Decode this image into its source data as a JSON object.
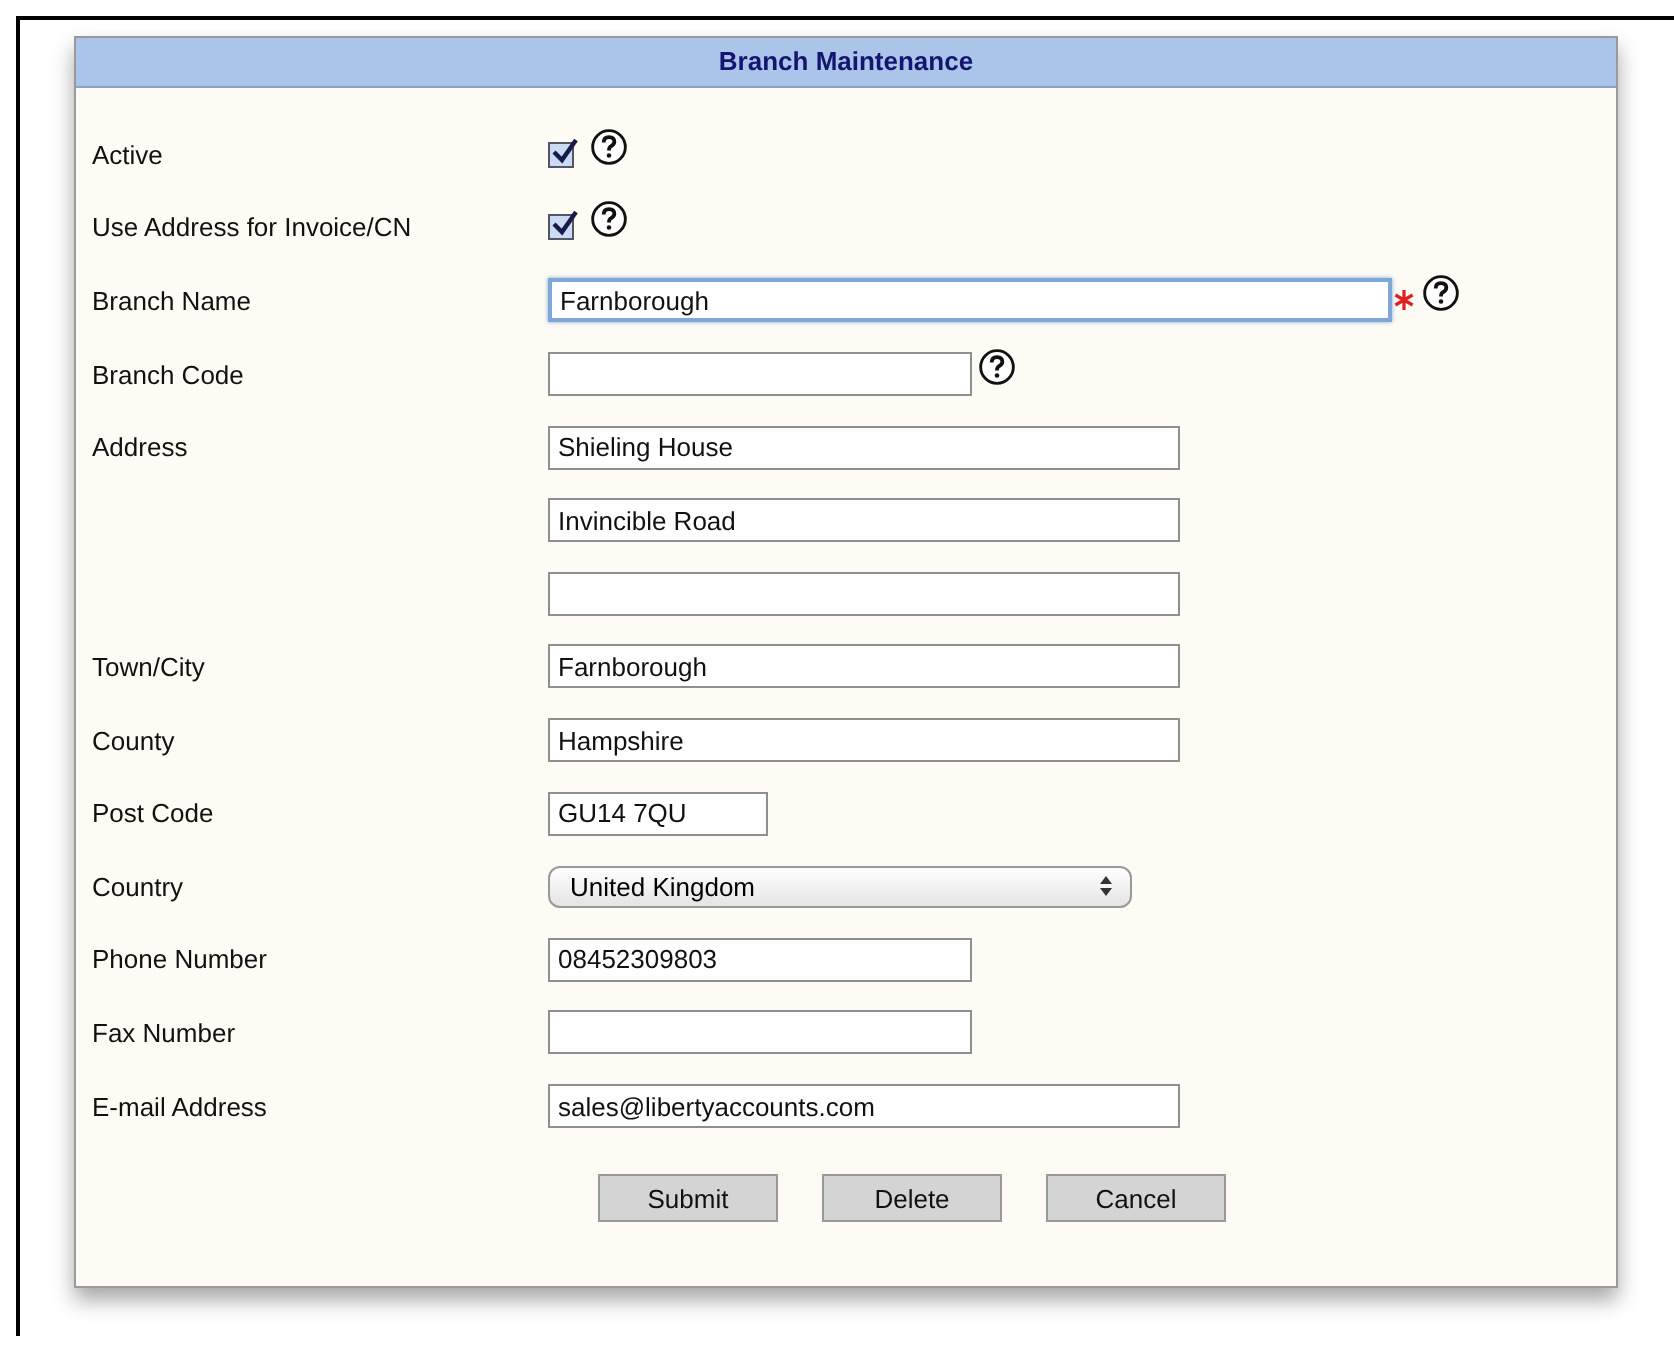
{
  "title": "Branch Maintenance",
  "fields": [
    {
      "kind": "checkbox",
      "label": "Active",
      "checked": true,
      "help": true
    },
    {
      "kind": "checkbox",
      "label": "Use Address for Invoice/CN",
      "checked": true,
      "help": true
    },
    {
      "kind": "text",
      "label": "Branch Name",
      "value": "Farnborough",
      "focused": true,
      "required": true,
      "help": true
    },
    {
      "kind": "text",
      "label": "Branch Code",
      "focused": false,
      "help": true
    },
    {
      "kind": "text",
      "label": "Address",
      "value": "Shieling House",
      "focused": false
    },
    {
      "kind": "text",
      "value": "Invincible Road",
      "focused": false
    },
    {
      "kind": "text",
      "focused": false
    },
    {
      "kind": "text",
      "label": "Town/City",
      "value": "Farnborough",
      "focused": false
    },
    {
      "kind": "text",
      "label": "County",
      "value": "Hampshire",
      "focused": false
    },
    {
      "kind": "text",
      "label": "Post Code",
      "value": "GU14 7QU",
      "focused": false
    },
    {
      "kind": "select",
      "label": "Country",
      "value": "United Kingdom"
    },
    {
      "kind": "text",
      "label": "Phone Number",
      "value": "08452309803",
      "focused": false
    },
    {
      "kind": "text",
      "label": "Fax Number",
      "focused": false
    },
    {
      "kind": "text",
      "label": "E-mail Address",
      "value": "sales@libertyaccounts.com",
      "focused": false
    }
  ],
  "buttons": [
    "Submit",
    "Delete",
    "Cancel"
  ]
}
